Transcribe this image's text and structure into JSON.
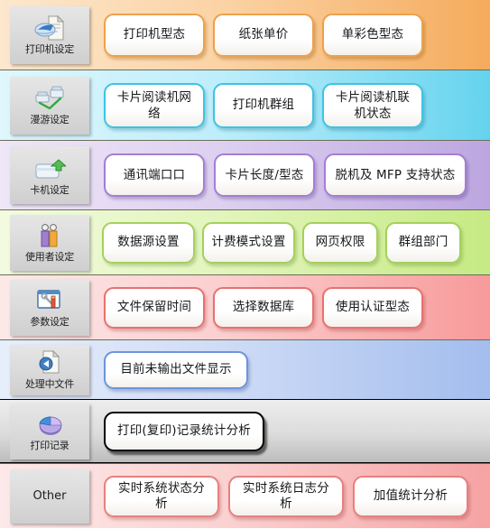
{
  "rows": [
    {
      "key": "printer-settings",
      "icon": "printer-document-icon",
      "label": "打印机设定",
      "buttons": [
        {
          "label": "打印机型态"
        },
        {
          "label": "纸张单价"
        },
        {
          "label": "单彩色型态"
        }
      ]
    },
    {
      "key": "roaming-settings",
      "icon": "roaming-printer-icon",
      "label": "漫游设定",
      "buttons": [
        {
          "label": "卡片阅读机网络"
        },
        {
          "label": "打印机群组"
        },
        {
          "label": "卡片阅读机联机状态"
        }
      ]
    },
    {
      "key": "card-machine-settings",
      "icon": "card-upload-icon",
      "label": "卡机设定",
      "buttons": [
        {
          "label": "通讯端口口"
        },
        {
          "label": "卡片长度/型态"
        },
        {
          "label": "脱机及 MFP 支持状态"
        }
      ]
    },
    {
      "key": "user-settings",
      "icon": "users-icon",
      "label": "使用者设定",
      "buttons": [
        {
          "label": "数据源设置"
        },
        {
          "label": "计费模式设置"
        },
        {
          "label": "网页权限"
        },
        {
          "label": "群组部门"
        }
      ]
    },
    {
      "key": "parameter-settings",
      "icon": "tools-window-icon",
      "label": "参数设定",
      "buttons": [
        {
          "label": "文件保留时间"
        },
        {
          "label": "选择数据库"
        },
        {
          "label": "使用认证型态"
        }
      ]
    },
    {
      "key": "processing-documents",
      "icon": "processing-file-icon",
      "label": "处理中文件",
      "buttons": [
        {
          "label": "目前未输出文件显示"
        }
      ]
    },
    {
      "key": "print-records",
      "icon": "pie-chart-icon",
      "label": "打印记录",
      "buttons": [
        {
          "label": "打印(复印)记录统计分析"
        }
      ]
    },
    {
      "key": "other",
      "icon": "",
      "label": "Other",
      "buttons": [
        {
          "label": "实时系统状态分析"
        },
        {
          "label": "实时系统日志分析"
        },
        {
          "label": "加值统计分析"
        }
      ]
    }
  ],
  "colors": {
    "row1": "#f5ab5c",
    "row2": "#65d3ee",
    "row3": "#bda6e0",
    "row4": "#c6ea84",
    "row5": "#f79a9a",
    "row6": "#a3bdee",
    "row7": "#bdbdbd",
    "row8": "#f6a3a3"
  }
}
